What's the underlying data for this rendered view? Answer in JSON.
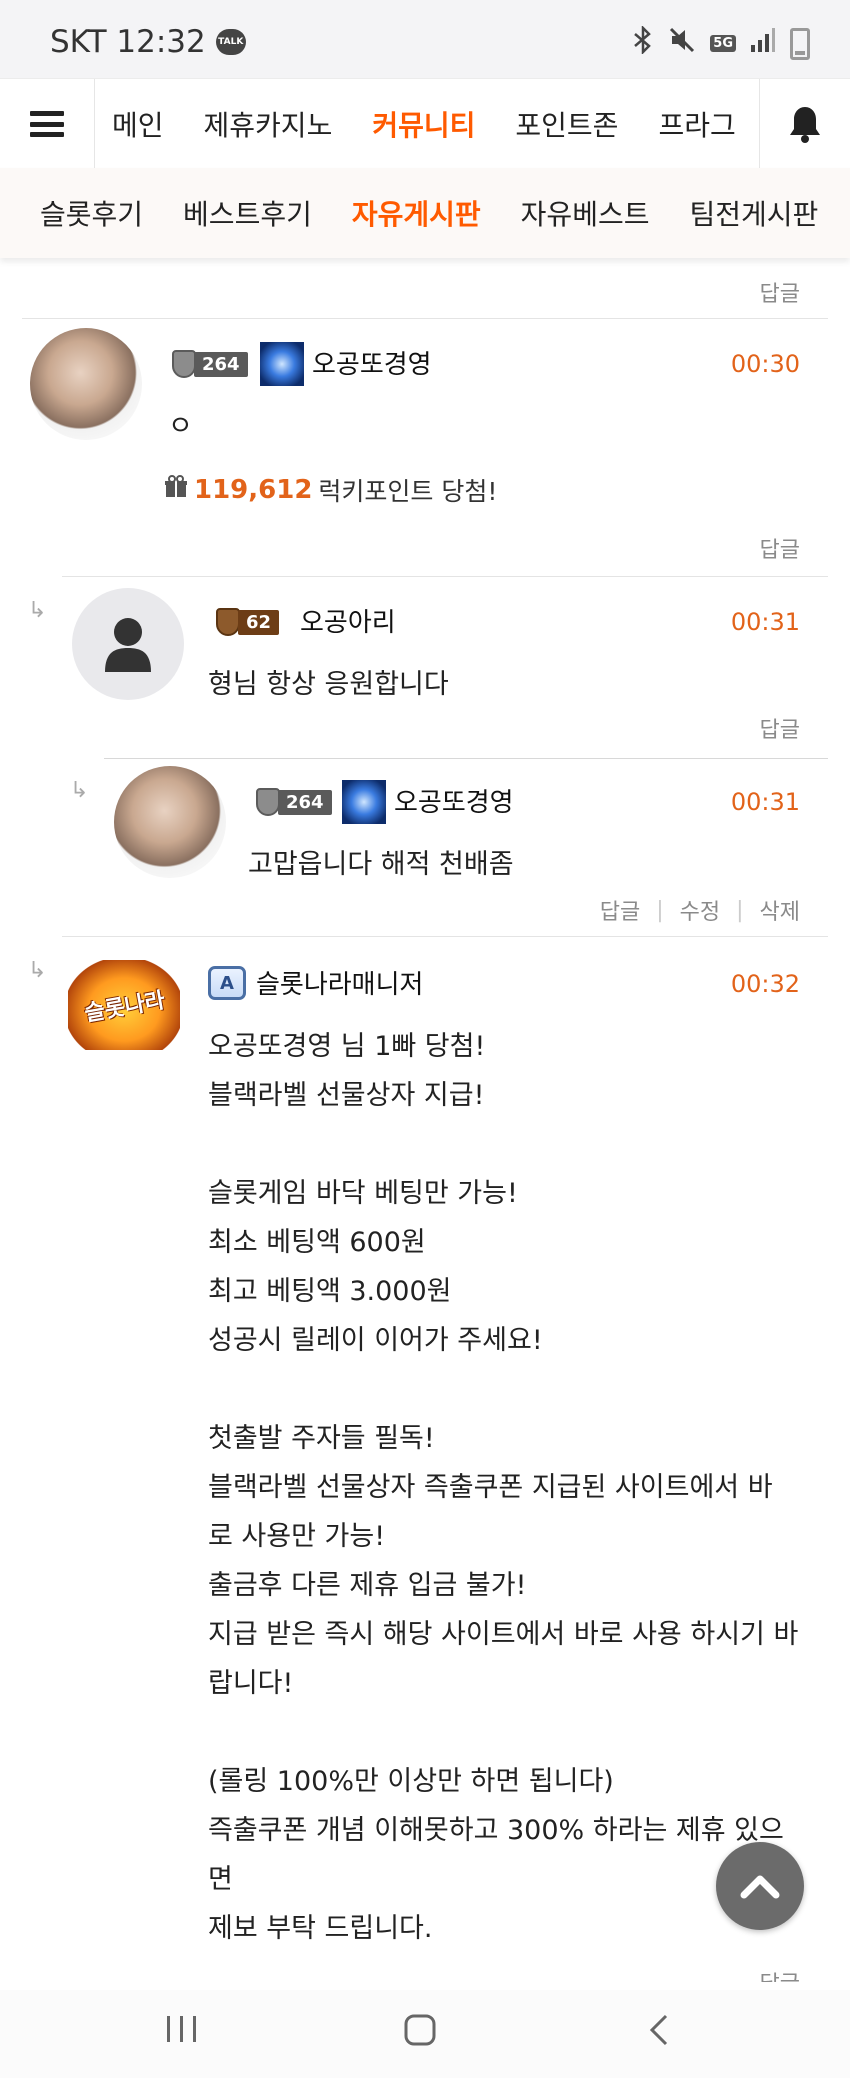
{
  "status_bar": {
    "carrier_time": "SKT 12:32",
    "talk_badge": "TALK",
    "network": "5G",
    "icons": [
      "bluetooth-icon",
      "mute-icon",
      "signal-icon",
      "battery-icon"
    ]
  },
  "main_nav": {
    "items": [
      {
        "label": "메인",
        "active": false
      },
      {
        "label": "제휴카지노",
        "active": false
      },
      {
        "label": "커뮤니티",
        "active": true
      },
      {
        "label": "포인트존",
        "active": false
      },
      {
        "label": "프라그",
        "active": false
      }
    ]
  },
  "sub_nav": {
    "items": [
      {
        "label": "슬롯후기",
        "active": false
      },
      {
        "label": "베스트후기",
        "active": false
      },
      {
        "label": "자유게시판",
        "active": true
      },
      {
        "label": "자유베스트",
        "active": false
      },
      {
        "label": "팀전게시판",
        "active": false
      }
    ]
  },
  "reply_label": "답글",
  "comments": [
    {
      "level": "264",
      "username": "오공또경영",
      "time": "00:30",
      "text": "ㅇ",
      "lucky_points": "119,612",
      "lucky_points_suffix": "럭키포인트 당첨!"
    },
    {
      "level": "62",
      "username": "오공아리",
      "time": "00:31",
      "text": "형님 항상 응원합니다"
    },
    {
      "level": "264",
      "username": "오공또경영",
      "time": "00:31",
      "text": "고맙읍니다 해적 천배좀",
      "actions": [
        "답글",
        "수정",
        "삭제"
      ]
    },
    {
      "admin_badge": "A",
      "logo_text": "슬롯나라",
      "username": "슬롯나라매니저",
      "time": "00:32",
      "lines": [
        "오공또경영 님 1빠 당첨!",
        "블랙라벨 선물상자 지급!",
        "",
        "슬롯게임 바닥 베팅만 가능!",
        "최소 베팅액 600원",
        "최고 베팅액 3.000원",
        "성공시 릴레이 이어가 주세요!",
        "",
        "첫출발 주자들 필독!",
        "블랙라벨 선물상자 즉출쿠폰 지급된 사이트에서 바",
        "로 사용만 가능!",
        "출금후 다른 제휴 입금 불가!",
        "지급 받은 즉시 해당 사이트에서 바로 사용 하시기 바",
        "랍니다!",
        "",
        "(롤링 100%만 이상만 하면 됩니다)",
        "즉출쿠폰 개념 이해못하고 300% 하라는 제휴 있으",
        "면",
        "제보 부탁 드립니다."
      ]
    }
  ]
}
